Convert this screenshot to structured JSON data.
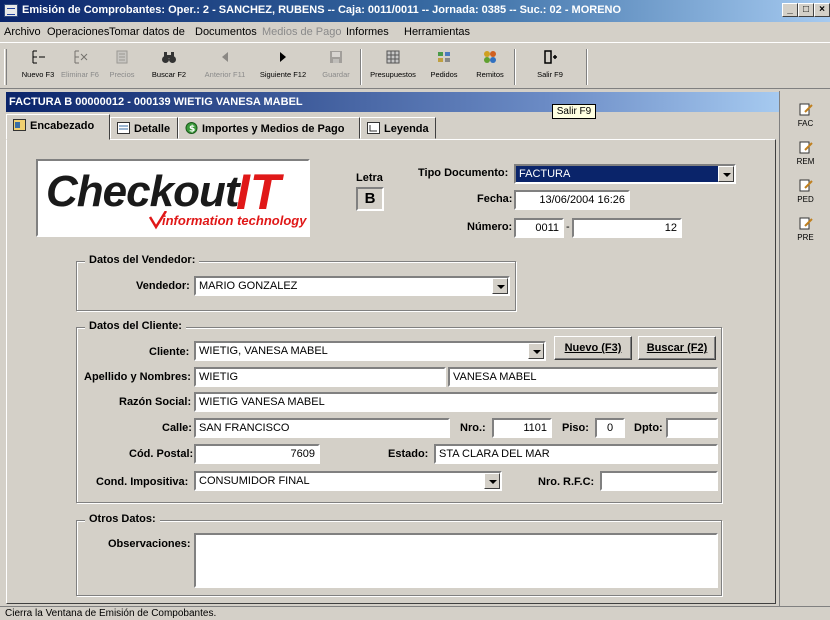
{
  "window": {
    "title": "Emisión de Comprobantes: Oper.: 2 - SANCHEZ, RUBENS  -- Caja: 0011/0011  -- Jornada: 0385  -- Suc.: 02 - MORENO",
    "min": "_",
    "max": "□",
    "close": "×"
  },
  "menu": [
    "Archivo",
    "Operaciones",
    "Tomar datos de",
    "Documentos",
    "Medios de Pago",
    "Informes",
    "Herramientas"
  ],
  "toolbar": {
    "nuevo": "Nuevo F3",
    "eliminar": "Eliminar F6",
    "precios": "Precios",
    "buscar": "Buscar F2",
    "anterior": "Anterior F11",
    "siguiente": "Siguiente F12",
    "guardar": "Guardar",
    "presupuestos": "Presupuestos",
    "pedidos": "Pedidos",
    "remitos": "Remitos",
    "salir": "Salir F9"
  },
  "tooltip": "Salir F9",
  "form_title": "FACTURA B 00000012 - 000139 WIETIG VANESA MABEL",
  "tabs": [
    "Encabezado",
    "Detalle",
    "Importes y Medios de Pago",
    "Leyenda"
  ],
  "right_panel": [
    "FAC",
    "REM",
    "PED",
    "PRE"
  ],
  "logo": {
    "text_a": "Check",
    "text_b": "out",
    "text_c": "IT",
    "tagline": "information technology"
  },
  "header": {
    "letra_label": "Letra",
    "letra_value": "B",
    "tipo_doc_label": "Tipo Documento:",
    "tipo_doc_value": "FACTURA",
    "fecha_label": "Fecha:",
    "fecha_value": "13/06/2004 16:26",
    "numero_label": "Número:",
    "numero_pv": "0011",
    "numero_sep": "-",
    "numero_value": "12"
  },
  "vendedor": {
    "group_title": "Datos del Vendedor:",
    "label": "Vendedor:",
    "value": "MARIO GONZALEZ"
  },
  "cliente": {
    "group_title": "Datos del Cliente:",
    "cliente_label": "Cliente:",
    "cliente_value": "WIETIG, VANESA MABEL",
    "nuevo_btn": "Nuevo (F3)",
    "buscar_btn": "Buscar (F2)",
    "apellido_label": "Apellido y Nombres:",
    "apellido_value": "WIETIG",
    "nombres_value": "VANESA MABEL",
    "razon_label": "Razón Social:",
    "razon_value": "WIETIG VANESA MABEL",
    "calle_label": "Calle:",
    "calle_value": "SAN FRANCISCO",
    "nro_label": "Nro.:",
    "nro_value": "1101",
    "piso_label": "Piso:",
    "piso_value": "0",
    "dpto_label": "Dpto:",
    "dpto_value": "",
    "cp_label": "Cód. Postal:",
    "cp_value": "7609",
    "estado_label": "Estado:",
    "estado_value": "STA CLARA DEL MAR",
    "cond_label": "Cond. Impositiva:",
    "cond_value": "CONSUMIDOR FINAL",
    "rfc_label": "Nro. R.F.C:",
    "rfc_value": ""
  },
  "otros": {
    "group_title": "Otros Datos:",
    "obs_label": "Observaciones:",
    "obs_value": ""
  },
  "status": "Cierra la Ventana de Emisión de Compobantes."
}
